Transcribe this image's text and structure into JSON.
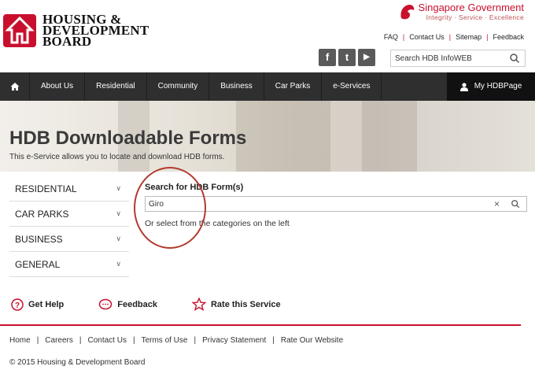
{
  "brand": {
    "logo_line1": "HOUSING &",
    "logo_line2": "DEVELOPMENT",
    "logo_line3": "BOARD",
    "sg_title_a": "Singapore",
    "sg_title_b": "Government",
    "sg_tagline": "Integrity · Service · Excellence",
    "accent_color": "#c8102e"
  },
  "top_links": [
    "FAQ",
    "Contact Us",
    "Sitemap",
    "Feedback"
  ],
  "social": {
    "facebook": "f",
    "twitter": "t",
    "youtube": "▶"
  },
  "site_search": {
    "placeholder": "Search HDB InfoWEB"
  },
  "nav": {
    "items": [
      "About Us",
      "Residential",
      "Community",
      "Business",
      "Car Parks",
      "e-Services"
    ],
    "my_page": "My HDBPage"
  },
  "banner": {
    "title": "HDB Downloadable Forms",
    "subtitle": "This e-Service allows you to locate and download HDB forms."
  },
  "sidebar": {
    "categories": [
      "RESIDENTIAL",
      "CAR PARKS",
      "BUSINESS",
      "GENERAL"
    ]
  },
  "form_search": {
    "label": "Search for HDB Form(s)",
    "value": "Giro",
    "hint": "Or select from the categories on the left"
  },
  "help": {
    "get_help": "Get Help",
    "feedback": "Feedback",
    "rate": "Rate this Service"
  },
  "footer": {
    "links": [
      "Home",
      "Careers",
      "Contact Us",
      "Terms of Use",
      "Privacy Statement",
      "Rate Our Website"
    ],
    "copyright": "© 2015 Housing & Development Board"
  }
}
